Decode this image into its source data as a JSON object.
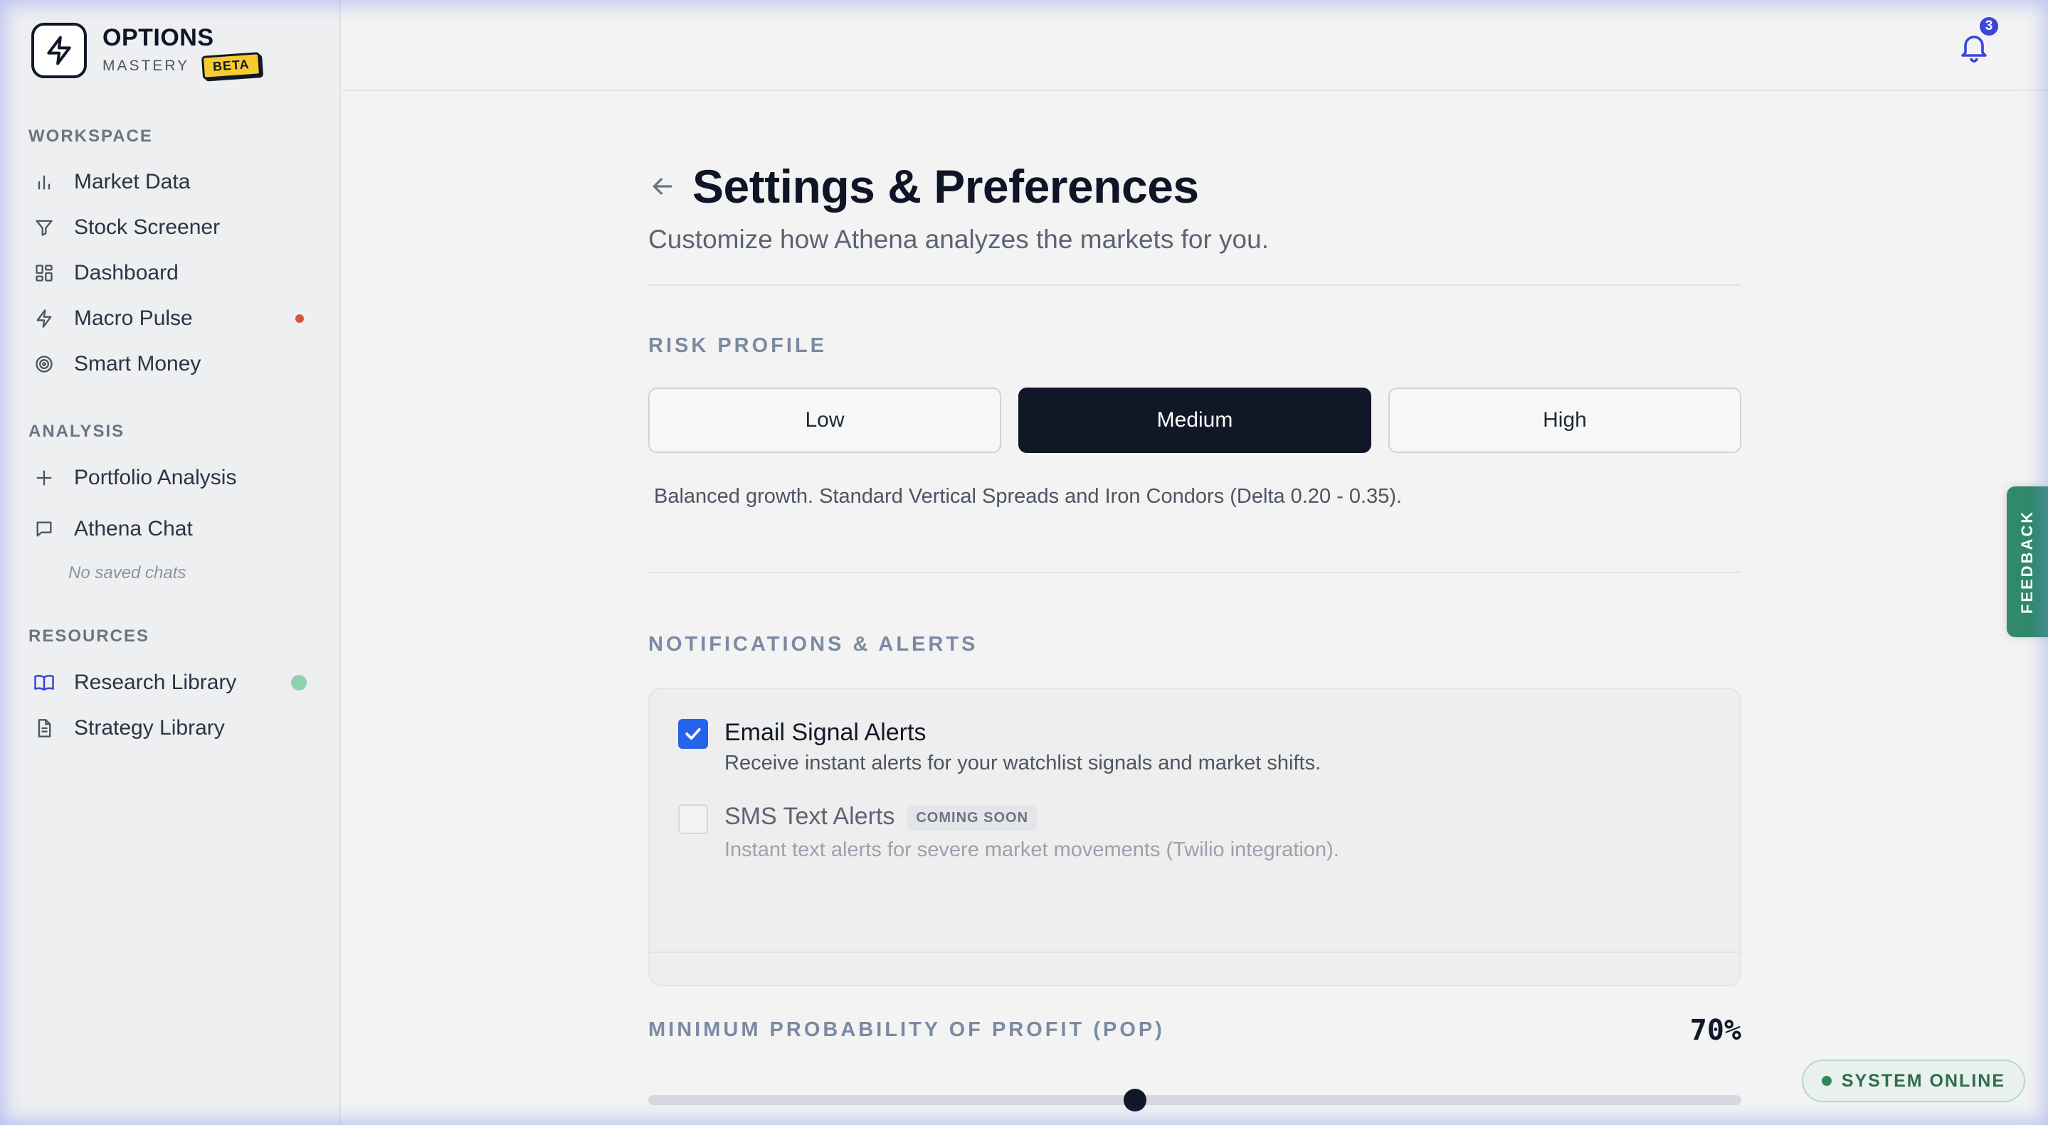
{
  "brand": {
    "title": "OPTIONS",
    "subtitle": "MASTERY",
    "badge": "BETA"
  },
  "sidebar": {
    "workspace_label": "WORKSPACE",
    "workspace_items": [
      {
        "label": "Market Data",
        "icon": "bar-chart-icon"
      },
      {
        "label": "Stock Screener",
        "icon": "filter-icon"
      },
      {
        "label": "Dashboard",
        "icon": "grid-icon"
      },
      {
        "label": "Macro Pulse",
        "icon": "lightning-icon",
        "indicator": "#d9533f"
      },
      {
        "label": "Smart Money",
        "icon": "target-icon"
      }
    ],
    "analysis_label": "ANALYSIS",
    "analysis_items": [
      {
        "label": "Portfolio Analysis",
        "icon": "plus-icon"
      },
      {
        "label": "Athena Chat",
        "icon": "chat-icon"
      }
    ],
    "no_chats": "No saved chats",
    "resources_label": "RESOURCES",
    "resources_items": [
      {
        "label": "Research Library",
        "icon": "book-icon",
        "indicator": "#8fd1ae"
      },
      {
        "label": "Strategy Library",
        "icon": "document-icon"
      }
    ]
  },
  "topbar": {
    "notification_count": "3"
  },
  "main": {
    "title": "Settings & Preferences",
    "subtitle": "Customize how Athena analyzes the markets for you.",
    "risk": {
      "label": "RISK PROFILE",
      "options": [
        "Low",
        "Medium",
        "High"
      ],
      "selected": "Medium",
      "description": "Balanced growth. Standard Vertical Spreads and Iron Condors (Delta 0.20 - 0.35)."
    },
    "notifications": {
      "label": "NOTIFICATIONS & ALERTS",
      "email": {
        "title": "Email Signal Alerts",
        "description": "Receive instant alerts for your watchlist signals and market shifts.",
        "checked": true
      },
      "sms": {
        "title": "SMS Text Alerts",
        "badge": "COMING SOON",
        "description": "Instant text alerts for severe market movements (Twilio integration).",
        "checked": false
      }
    },
    "pop": {
      "label": "MINIMUM PROBABILITY OF PROFIT (POP)",
      "value_text": "70%",
      "value": 70,
      "slider_fraction": 0.445
    }
  },
  "feedback_label": "FEEDBACK",
  "status": {
    "label": "SYSTEM ONLINE",
    "color": "#2f8a5c"
  },
  "colors": {
    "accent": "#2563eb",
    "dark": "#101828",
    "badge": "#3b46d8"
  }
}
